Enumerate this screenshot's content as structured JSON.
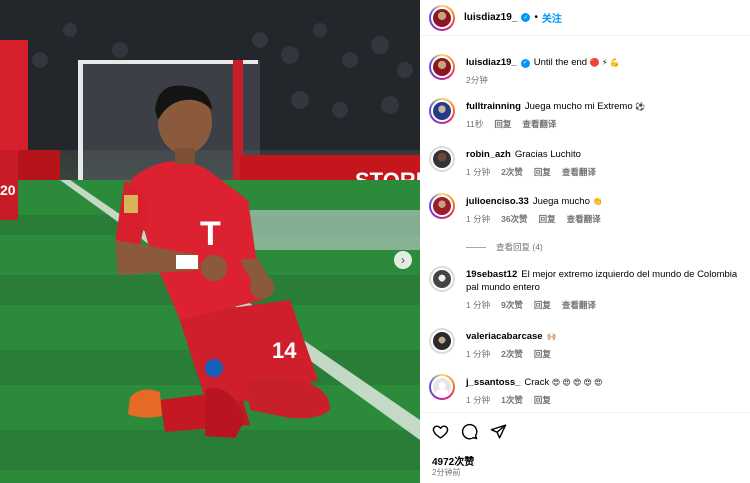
{
  "photo": {
    "player_shirt_number": "14",
    "sponsor_text": "T",
    "teammate_shirt_number": "20",
    "banner_text": "STORE",
    "next_icon": "chevron-right-icon"
  },
  "header": {
    "username": "luisdiaz19_",
    "separator": "•",
    "follow_label": "关注"
  },
  "caption": {
    "username": "luisdiaz19_",
    "text": "Until the end",
    "emojis": "🔴 ⚡ 💪",
    "time": "2分钟"
  },
  "comments": [
    {
      "username": "fulltrainning",
      "text": "Juega mucho mi Extremo",
      "emoji": "⚽",
      "time": "11秒",
      "likes": "",
      "reply": "回复",
      "translate": "查看翻译"
    },
    {
      "username": "robin_azh",
      "text": "Gracias Luchito",
      "emoji": "",
      "time": "1 分钟",
      "likes": "2次赞",
      "reply": "回复",
      "translate": "查看翻译"
    },
    {
      "username": "julioenciso.33",
      "text": "Juega mucho",
      "emoji": "👏",
      "time": "1 分钟",
      "likes": "36次赞",
      "reply": "回复",
      "translate": "查看翻译"
    },
    {
      "username": "19sebast12",
      "text": "El mejor extremo izquierdo del mundo de Colombia pal mundo entero",
      "emoji": "",
      "time": "1 分钟",
      "likes": "9次赞",
      "reply": "回复",
      "translate": "查看翻译"
    },
    {
      "username": "valeriacabarcase",
      "text": "",
      "emoji": "🙌🏼",
      "time": "1 分钟",
      "likes": "2次赞",
      "reply": "回复",
      "translate": ""
    },
    {
      "username": "j_ssantoss_",
      "text": "Crack",
      "emoji": "😍 😍 😍 😍 😍",
      "time": "1 分钟",
      "likes": "1次赞",
      "reply": "回复",
      "translate": ""
    }
  ],
  "view_replies": "查看回复 (4)",
  "footer": {
    "likes": "4972次赞",
    "posted": "2分钟前",
    "icons": [
      "heart-icon",
      "comment-icon",
      "share-icon"
    ]
  }
}
